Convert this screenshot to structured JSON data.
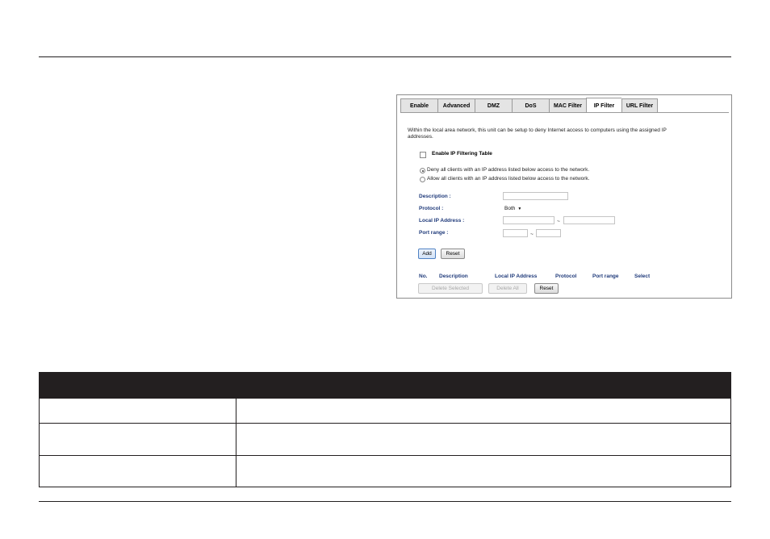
{
  "tabs": [
    {
      "label": "Enable",
      "active": false
    },
    {
      "label": "Advanced",
      "active": false
    },
    {
      "label": "DMZ",
      "active": false
    },
    {
      "label": "DoS",
      "active": false
    },
    {
      "label": "MAC Filter",
      "active": false
    },
    {
      "label": "IP Filter",
      "active": true
    },
    {
      "label": "URL Filter",
      "active": false
    }
  ],
  "intro_line1": "Within the local area network, this unit can be setup to deny Internet access to computers using the assigned IP",
  "intro_line2": "addresses.",
  "enable_checkbox_label": "Enable IP Filtering Table",
  "radio_deny_label": "Deny all clients with an IP address listed below access to the network.",
  "radio_allow_label": "Allow all clients with an IP address listed below access to the network.",
  "form": {
    "description_label": "Description :",
    "protocol_label": "Protocol :",
    "protocol_value": "Both",
    "local_ip_label": "Local IP Address :",
    "port_range_label": "Port range :",
    "range_separator": "~"
  },
  "buttons": {
    "add": "Add",
    "reset": "Reset",
    "delete_selected": "Delete Selected",
    "delete_all": "Delete All",
    "reset2": "Reset"
  },
  "columns": [
    "No.",
    "Description",
    "Local IP Address",
    "Protocol",
    "Port range",
    "Select"
  ],
  "colors": {
    "label_blue": "#1f3a7a",
    "table_header": "#231f20"
  }
}
